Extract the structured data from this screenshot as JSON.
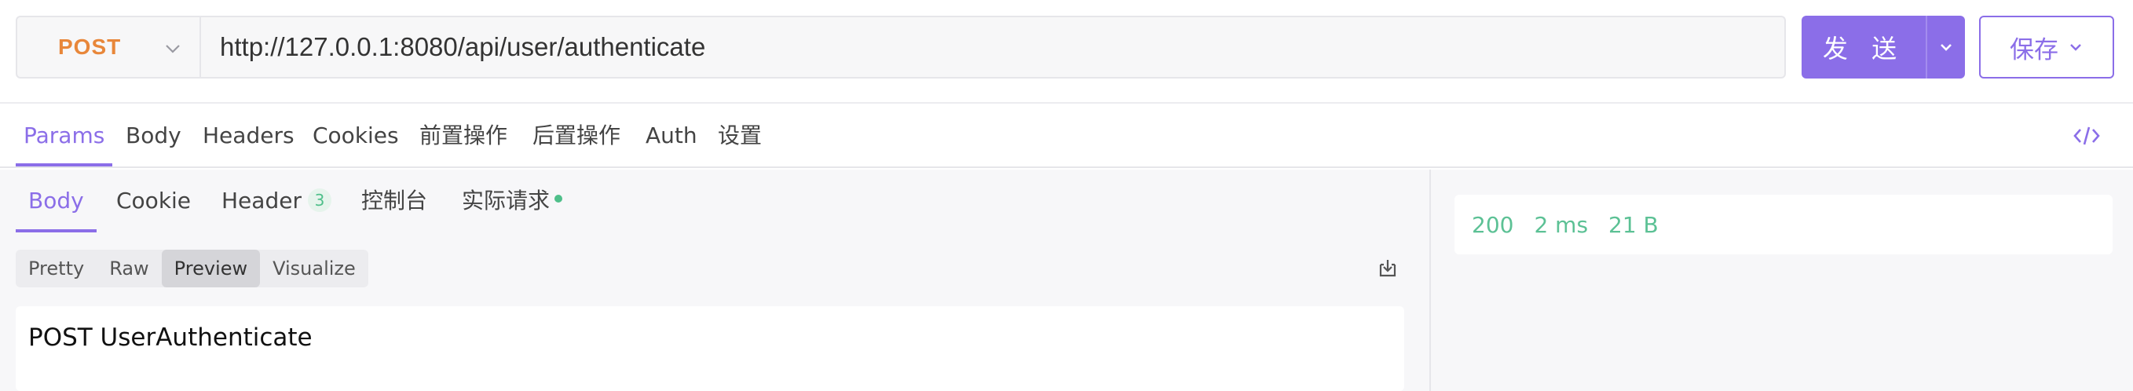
{
  "request": {
    "method": "POST",
    "url": "http://127.0.0.1:8080/api/user/authenticate",
    "send_label": "发 送",
    "save_label": "保存"
  },
  "request_tabs": [
    {
      "label": "Params",
      "active": true
    },
    {
      "label": "Body"
    },
    {
      "label": "Headers"
    },
    {
      "label": "Cookies"
    },
    {
      "label": "前置操作"
    },
    {
      "label": "后置操作"
    },
    {
      "label": "Auth"
    },
    {
      "label": "设置"
    }
  ],
  "response_tabs": [
    {
      "label": "Body",
      "active": true
    },
    {
      "label": "Cookie"
    },
    {
      "label": "Header",
      "badge": "3"
    },
    {
      "label": "控制台"
    },
    {
      "label": "实际请求",
      "dot": true
    }
  ],
  "view_modes": [
    {
      "label": "Pretty"
    },
    {
      "label": "Raw"
    },
    {
      "label": "Preview",
      "active": true
    },
    {
      "label": "Visualize"
    }
  ],
  "preview_content": "POST UserAuthenticate",
  "response_meta": {
    "status": "200",
    "time": "2 ms",
    "size": "21 B"
  },
  "colors": {
    "accent": "#8b6ee8",
    "method": "#e8873a",
    "success": "#4fbf8a"
  },
  "icons": [
    "chevron-down-icon",
    "code-icon",
    "download-icon"
  ]
}
